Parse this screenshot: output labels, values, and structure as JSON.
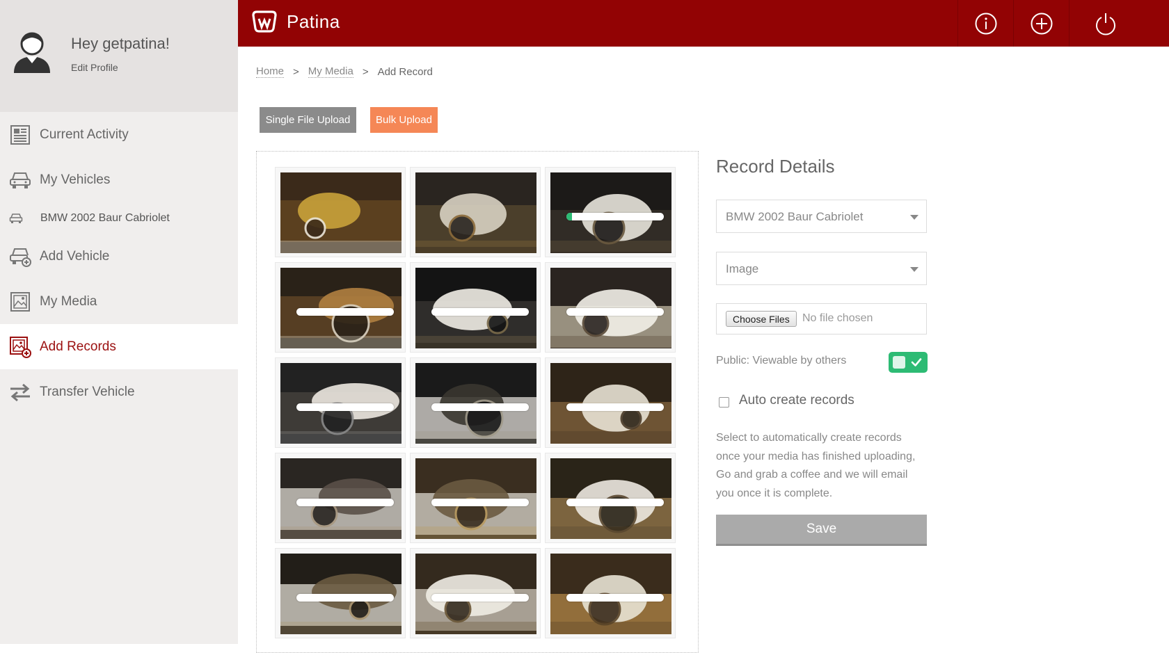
{
  "profile": {
    "greeting": "Hey getpatina!",
    "edit_label": "Edit Profile"
  },
  "nav": [
    {
      "label": "Current Activity",
      "icon": "newspaper-icon",
      "active": false,
      "sub": false
    },
    {
      "label": "My Vehicles",
      "icon": "car-icon",
      "active": false,
      "sub": false
    },
    {
      "label": "BMW 2002 Baur Cabriolet",
      "icon": "car-small-icon",
      "active": false,
      "sub": true
    },
    {
      "label": "Add Vehicle",
      "icon": "car-add-icon",
      "active": false,
      "sub": false
    },
    {
      "label": "My Media",
      "icon": "image-icon",
      "active": false,
      "sub": false
    },
    {
      "label": "Add Records",
      "icon": "image-add-icon",
      "active": true,
      "sub": false
    },
    {
      "label": "Transfer Vehicle",
      "icon": "transfer-arrows-icon",
      "active": false,
      "sub": false
    }
  ],
  "header": {
    "brand": "Patina",
    "actions": [
      {
        "name": "info-icon"
      },
      {
        "name": "plus-circle-icon"
      },
      {
        "name": "power-icon"
      }
    ]
  },
  "breadcrumb": {
    "home": "Home",
    "media": "My Media",
    "current": "Add Record",
    "separator": ">"
  },
  "upload": {
    "single_label": "Single File Upload",
    "bulk_label": "Bulk Upload"
  },
  "media": {
    "tiles": [
      {
        "scene": "workshop-lift",
        "progress": null
      },
      {
        "scene": "car-on-stand",
        "progress": null
      },
      {
        "scene": "underside",
        "progress": 0.06
      },
      {
        "scene": "workbench",
        "progress": 0
      },
      {
        "scene": "brake-disc",
        "progress": 0
      },
      {
        "scene": "wheel-arch",
        "progress": 0
      },
      {
        "scene": "wheel-closeup",
        "progress": 0
      },
      {
        "scene": "wheel-arch-2",
        "progress": 0
      },
      {
        "scene": "shop-floor",
        "progress": 0
      },
      {
        "scene": "engine-bay",
        "progress": 0
      },
      {
        "scene": "car-front",
        "progress": 0
      },
      {
        "scene": "car-side",
        "progress": 0
      },
      {
        "scene": "engine-bay-2",
        "progress": 0
      },
      {
        "scene": "trunk-open",
        "progress": 0
      },
      {
        "scene": "garage-wide",
        "progress": 0
      }
    ]
  },
  "details": {
    "title": "Record Details",
    "vehicle_value": "BMW 2002 Baur Cabriolet",
    "type_value": "Image",
    "choose_files_label": "Choose Files",
    "no_file_text": "No file chosen",
    "public_label": "Public: Viewable by others",
    "public_on": true,
    "auto_label": "Auto create records",
    "auto_checked": false,
    "help_text": "Select to automatically create records once your media has finished uploading, Go and grab a coffee and we will email you once it is complete.",
    "save_label": "Save"
  },
  "colors": {
    "brand_red": "#920304",
    "active_text": "#9b1010",
    "bulk_orange": "#f58756",
    "progress_green": "#2dbb74",
    "sidebar_bg": "#f0eeed"
  }
}
